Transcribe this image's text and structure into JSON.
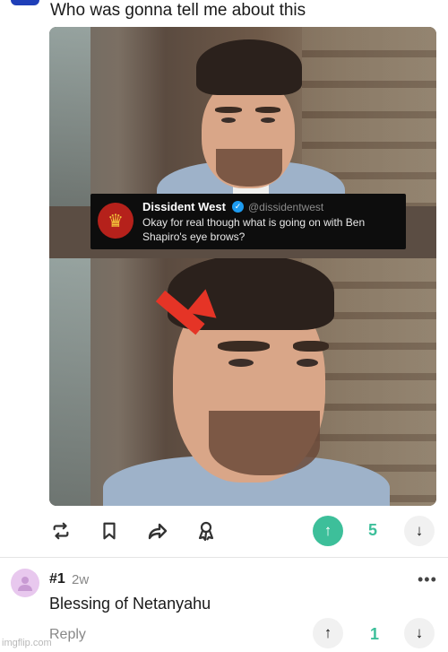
{
  "post": {
    "title": "Who was gonna tell me about this"
  },
  "tweet": {
    "name": "Dissident West",
    "verified_icon": "verified-check-icon",
    "handle": "@dissidentwest",
    "text": "Okay for real though what is going on with Ben Shapiro's eye brows?",
    "logo": "double-headed-eagle-icon"
  },
  "actions": {
    "icons": [
      "repost-icon",
      "bookmark-icon",
      "share-icon",
      "award-icon"
    ],
    "upvote_icon": "arrow-up-icon",
    "downvote_icon": "arrow-down-icon",
    "score": "5",
    "upvote_color": "#3dbf9a",
    "score_color": "#3dbf9a"
  },
  "comment": {
    "rank": "#1",
    "time": "2w",
    "text": "Blessing of Netanyahu",
    "reply_label": "Reply",
    "score": "1",
    "more_icon": "more-dots-icon",
    "avatar_color": "#e8c8ee"
  },
  "watermark": "imgflip.com"
}
